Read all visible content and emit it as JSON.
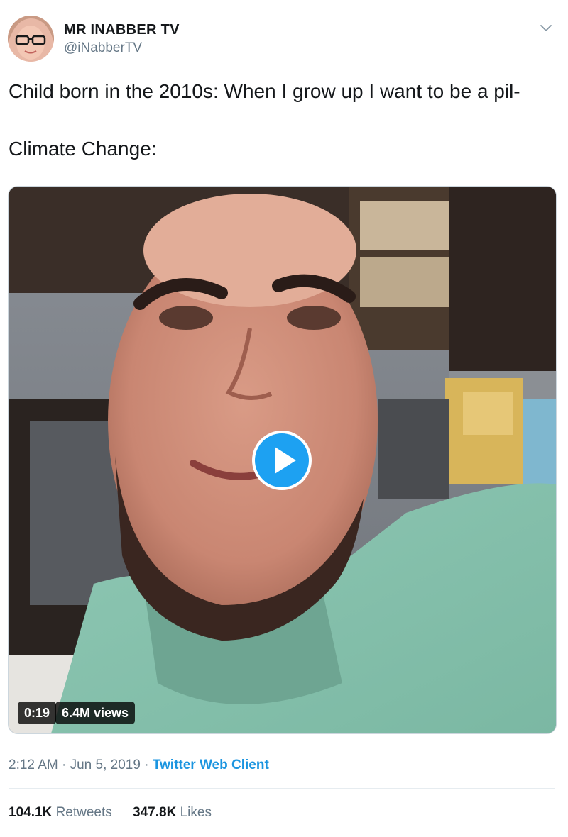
{
  "author": {
    "name": "MR INABBER TV",
    "handle": "@iNabberTV"
  },
  "tweet": {
    "line1": "Child born in the 2010s: When I grow up I want to be a pil-",
    "line2": "Climate Change:"
  },
  "video": {
    "duration": "0:19",
    "views": "6.4M views",
    "play_icon": "play-icon"
  },
  "meta": {
    "time": "2:12 AM",
    "sep1": "·",
    "date": "Jun 5, 2019",
    "sep2": "·",
    "source": "Twitter Web Client"
  },
  "stats": {
    "retweets_count": "104.1K",
    "retweets_label": "Retweets",
    "likes_count": "347.8K",
    "likes_label": "Likes"
  },
  "colors": {
    "link": "#1b95e0",
    "secondary_text": "#657786",
    "play_button": "#1da1f2"
  }
}
